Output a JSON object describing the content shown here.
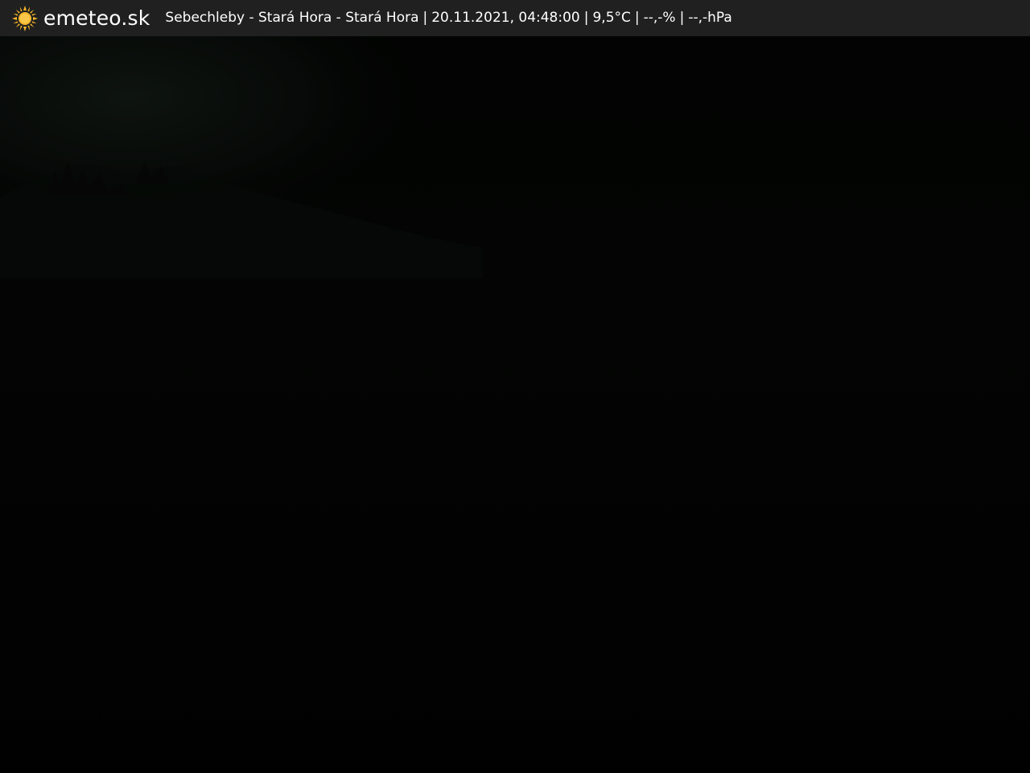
{
  "header": {
    "logo_icon": "sun-icon",
    "logo_color": "#f7b62a",
    "brand": "emeteo.sk",
    "location": "Sebechleby - Stará Hora - Stará Hora",
    "datetime": "20.11.2021, 04:48:00",
    "temperature": "9,5°C",
    "humidity": "--,-%",
    "pressure": "--,-hPa",
    "separator": "|"
  },
  "image": {
    "subject": "webcam-night-view",
    "colors": {
      "sky": "#010201",
      "haze": "#0b100d",
      "hills": "#060807"
    }
  }
}
